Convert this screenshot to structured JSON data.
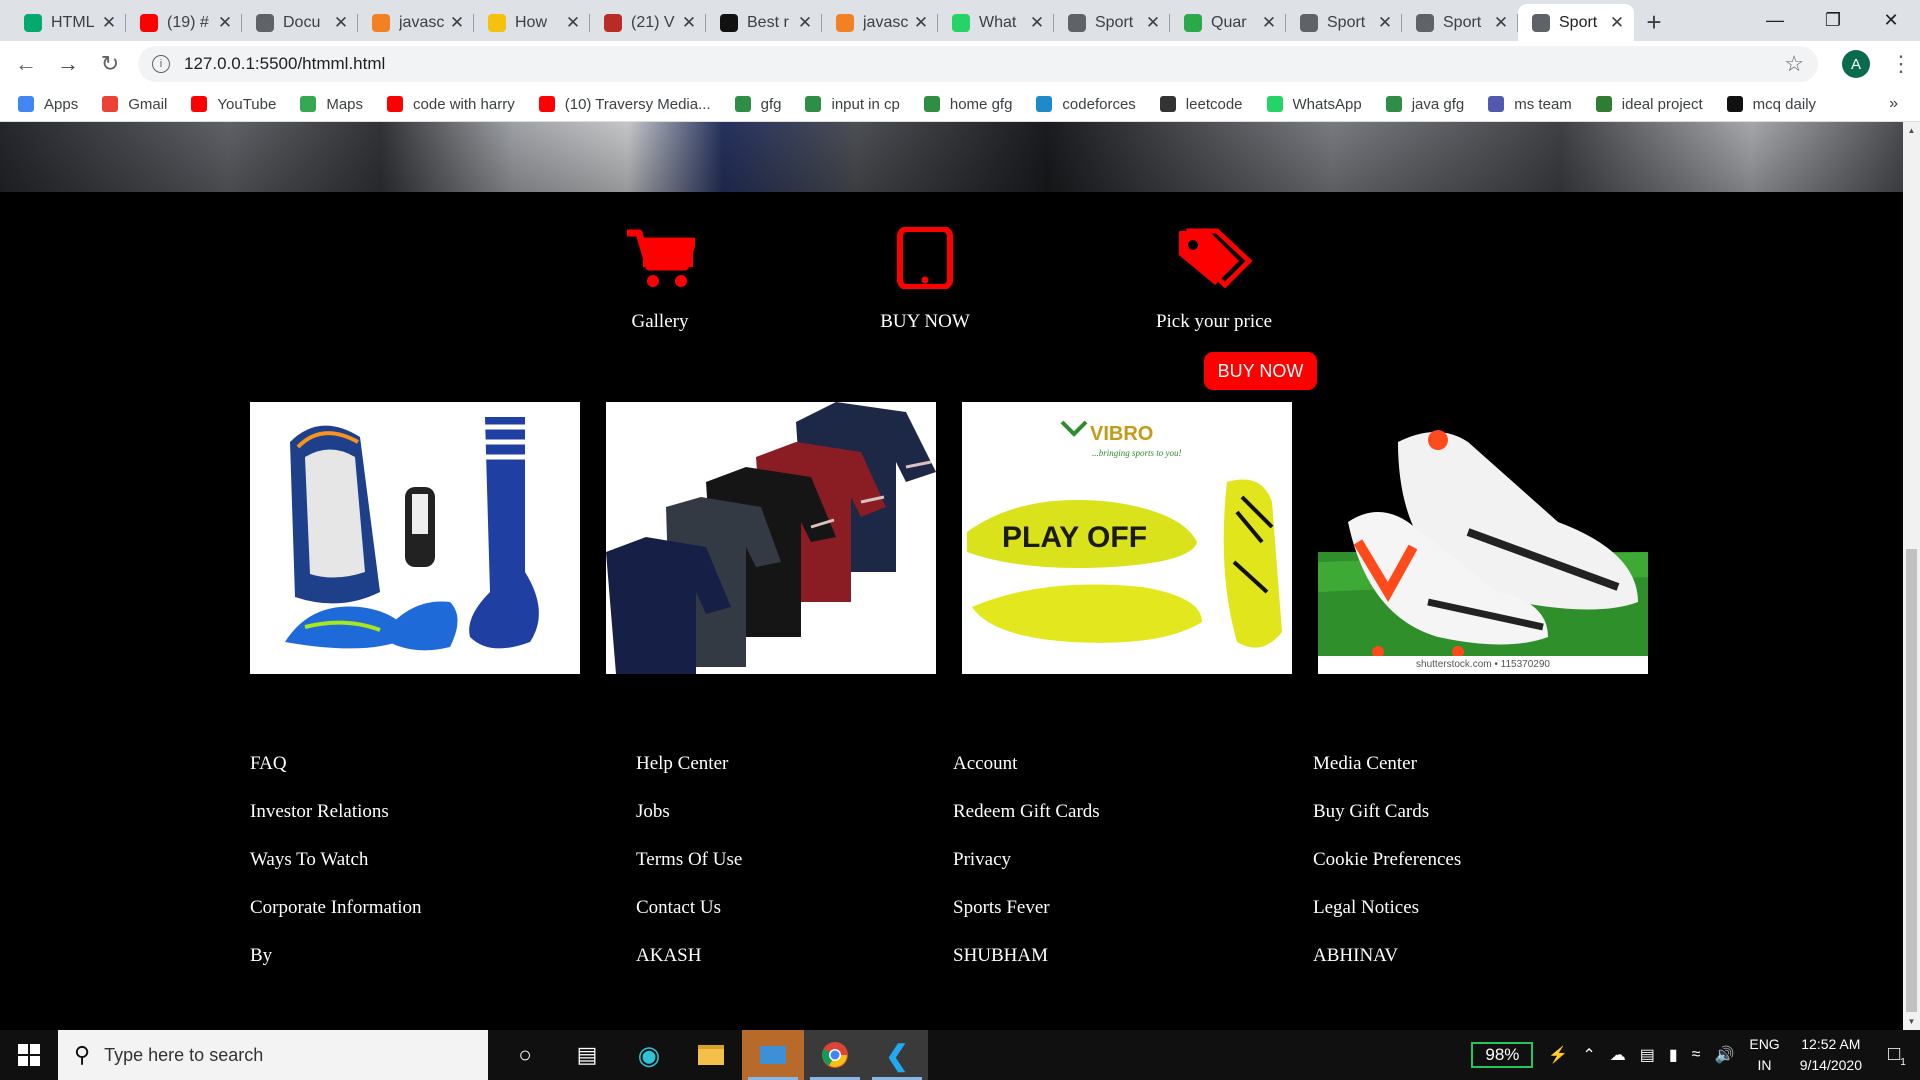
{
  "browser": {
    "tabs": [
      {
        "label": "HTML",
        "icon": "w3schools-icon",
        "color": "#04aa6d"
      },
      {
        "label": "(19) #",
        "icon": "youtube-icon",
        "color": "#ff0000"
      },
      {
        "label": "Docu",
        "icon": "globe-icon",
        "color": "#5f6368"
      },
      {
        "label": "javasc",
        "icon": "stackoverflow-icon",
        "color": "#f48024"
      },
      {
        "label": "How",
        "icon": "emoji-icon",
        "color": "#f4c20d"
      },
      {
        "label": "(21) V",
        "icon": "quora-icon",
        "color": "#b92b27"
      },
      {
        "label": "Best r",
        "icon": "angular-icon",
        "color": "#111111"
      },
      {
        "label": "javasc",
        "icon": "stackoverflow-icon",
        "color": "#f48024"
      },
      {
        "label": "What",
        "icon": "whatsapp-icon",
        "color": "#25d366"
      },
      {
        "label": "Sport",
        "icon": "globe-icon",
        "color": "#5f6368"
      },
      {
        "label": "Quar",
        "icon": "px-icon",
        "color": "#2aa84a"
      },
      {
        "label": "Sport",
        "icon": "globe-icon",
        "color": "#5f6368"
      },
      {
        "label": "Sport",
        "icon": "globe-icon",
        "color": "#5f6368"
      },
      {
        "label": "Sport",
        "icon": "globe-icon",
        "color": "#5f6368",
        "active": true
      }
    ],
    "url": "127.0.0.1:5500/htmml.html",
    "profile_initial": "A",
    "bookmarks": [
      {
        "label": "Apps",
        "icon": "apps-grid-icon",
        "color": "#4285f4"
      },
      {
        "label": "Gmail",
        "icon": "gmail-icon",
        "color": "#ea4335"
      },
      {
        "label": "YouTube",
        "icon": "youtube-icon",
        "color": "#ff0000"
      },
      {
        "label": "Maps",
        "icon": "maps-icon",
        "color": "#34a853"
      },
      {
        "label": "code with harry",
        "icon": "youtube-icon",
        "color": "#ff0000"
      },
      {
        "label": "(10) Traversy Media...",
        "icon": "youtube-icon",
        "color": "#ff0000"
      },
      {
        "label": "gfg",
        "icon": "gfg-icon",
        "color": "#2f8d46"
      },
      {
        "label": "input in cp",
        "icon": "gfg-icon",
        "color": "#2f8d46"
      },
      {
        "label": "home gfg",
        "icon": "gfg-icon",
        "color": "#2f8d46"
      },
      {
        "label": "codeforces",
        "icon": "codeforces-icon",
        "color": "#1f8acb"
      },
      {
        "label": "leetcode",
        "icon": "leetcode-icon",
        "color": "#333333"
      },
      {
        "label": "WhatsApp",
        "icon": "whatsapp-icon",
        "color": "#25d366"
      },
      {
        "label": "java gfg",
        "icon": "gfg-icon",
        "color": "#2f8d46"
      },
      {
        "label": "ms team",
        "icon": "teams-icon",
        "color": "#5558af"
      },
      {
        "label": "ideal project",
        "icon": "project-icon",
        "color": "#2e7d32"
      },
      {
        "label": "mcq daily",
        "icon": "sf-icon",
        "color": "#111111"
      }
    ],
    "bookmarks_more": "»"
  },
  "page": {
    "features": [
      {
        "label": "Gallery",
        "icon": "cart-icon"
      },
      {
        "label": "BUY NOW",
        "icon": "tablet-icon"
      },
      {
        "label": "Pick your price",
        "icon": "tags-icon"
      }
    ],
    "buy_now_button": "BUY NOW",
    "products": [
      {
        "name": "football-kit-product",
        "alt": "Football kit with bag, shoes, shin guard and socks"
      },
      {
        "name": "jerseys-product",
        "alt": "Cycling jerseys"
      },
      {
        "name": "vibro-shoes-product",
        "alt": "Vibro Sports Play Off shoes",
        "brand": "VIBRO",
        "tagline": "...bringing sports to you!",
        "print": "PLAY OFF"
      },
      {
        "name": "football-boots-product",
        "alt": "Football boots on grass",
        "caption": "shutterstock.com • 115370290"
      }
    ],
    "footer_columns": [
      [
        "FAQ",
        "Investor Relations",
        "Ways To Watch",
        "Corporate Information",
        "By"
      ],
      [
        "Help Center",
        "Jobs",
        "Terms Of Use",
        "Contact Us",
        "AKASH"
      ],
      [
        "Account",
        "Redeem Gift Cards",
        "Privacy",
        "Sports Fever",
        "SHUBHAM"
      ],
      [
        "Media Center",
        "Buy Gift Cards",
        "Cookie Preferences",
        "Legal Notices",
        "ABHINAV"
      ]
    ],
    "accent_color": "#ff0000"
  },
  "taskbar": {
    "search_placeholder": "Type here to search",
    "battery": "98%",
    "lang_line1": "ENG",
    "lang_line2": "IN",
    "time": "12:52 AM",
    "date": "9/14/2020",
    "notification_count": "1"
  }
}
